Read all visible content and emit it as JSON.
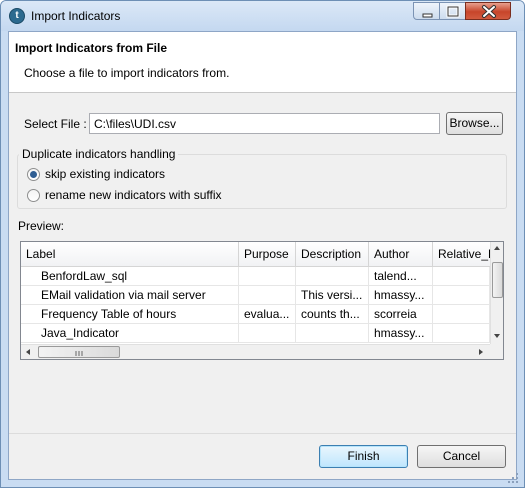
{
  "window": {
    "title": "Import Indicators",
    "icon": "talend-app-icon"
  },
  "controls": {
    "minimize": "minimize-icon",
    "maximize": "maximize-icon",
    "close": "close-icon"
  },
  "header": {
    "title": "Import Indicators from File",
    "description": "Choose a file to import indicators from."
  },
  "file": {
    "label": "Select File :",
    "value": "C:\\files\\UDI.csv",
    "browse_label": "Browse..."
  },
  "duplicates": {
    "title": "Duplicate indicators handling",
    "options": [
      {
        "label": "skip existing indicators",
        "selected": true
      },
      {
        "label": "rename new indicators with suffix",
        "selected": false
      }
    ]
  },
  "preview": {
    "label": "Preview:",
    "columns": [
      "Label",
      "Purpose",
      "Description",
      "Author",
      "Relative_P"
    ],
    "rows": [
      [
        "BenfordLaw_sql",
        "",
        "",
        "talend...",
        ""
      ],
      [
        "EMail validation via mail server",
        "",
        "This versi...",
        "hmassy...",
        ""
      ],
      [
        "Frequency Table of hours",
        "evalua...",
        "counts th...",
        "scorreia",
        ""
      ],
      [
        "Java_Indicator",
        "",
        "",
        "hmassy...",
        ""
      ]
    ]
  },
  "footer": {
    "finish_label": "Finish",
    "cancel_label": "Cancel"
  }
}
